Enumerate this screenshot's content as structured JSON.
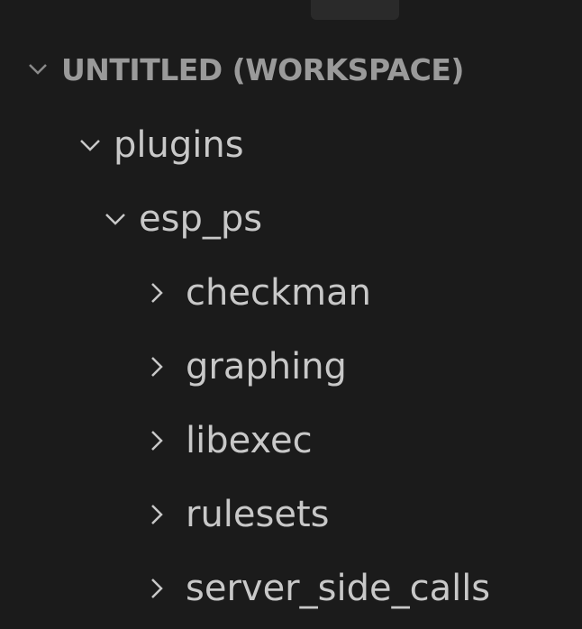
{
  "explorer": {
    "workspace_title": "UNTITLED (WORKSPACE)",
    "tree": [
      {
        "label": "plugins",
        "expanded": true
      },
      {
        "label": "esp_ps",
        "expanded": true
      },
      {
        "label": "checkman",
        "expanded": false
      },
      {
        "label": "graphing",
        "expanded": false
      },
      {
        "label": "libexec",
        "expanded": false
      },
      {
        "label": "rulesets",
        "expanded": false
      },
      {
        "label": "server_side_calls",
        "expanded": false
      }
    ]
  },
  "colors": {
    "background": "#1b1b1b",
    "text": "#c8c8c8",
    "header_text": "#9a9a9a"
  }
}
